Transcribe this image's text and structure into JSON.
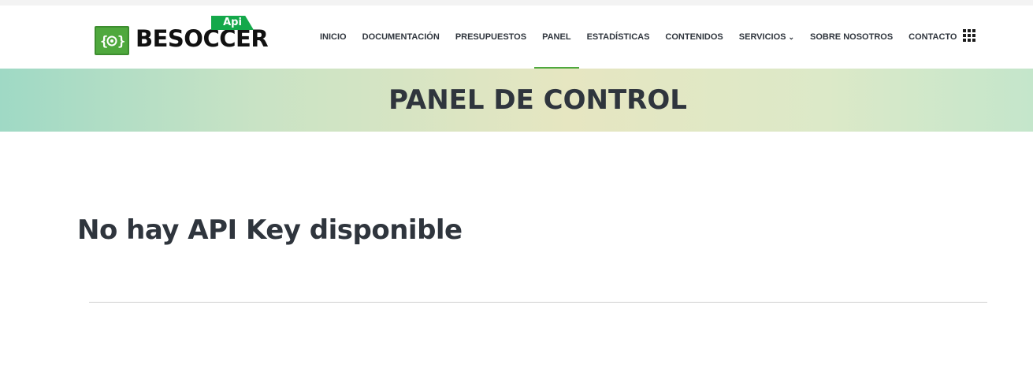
{
  "brand": {
    "wordmark": "BESOCCER",
    "badge": "Api",
    "icon": "bracket-ball-icon",
    "accent_color": "#4fa83d"
  },
  "nav": {
    "items": [
      {
        "label": "INICIO"
      },
      {
        "label": "DOCUMENTACIÓN"
      },
      {
        "label": "PRESUPUESTOS"
      },
      {
        "label": "PANEL",
        "active": true
      },
      {
        "label": "ESTADÍSTICAS"
      },
      {
        "label": "CONTENIDOS"
      },
      {
        "label": "SERVICIOS",
        "dropdown": true
      },
      {
        "label": "SOBRE NOSOTROS"
      },
      {
        "label": "CONTACTO"
      }
    ],
    "dropdown_icon": "chevron-down-icon",
    "apps_icon": "grid-menu-icon"
  },
  "banner": {
    "title": "PANEL DE CONTROL"
  },
  "main": {
    "heading": "No hay API Key disponible"
  }
}
